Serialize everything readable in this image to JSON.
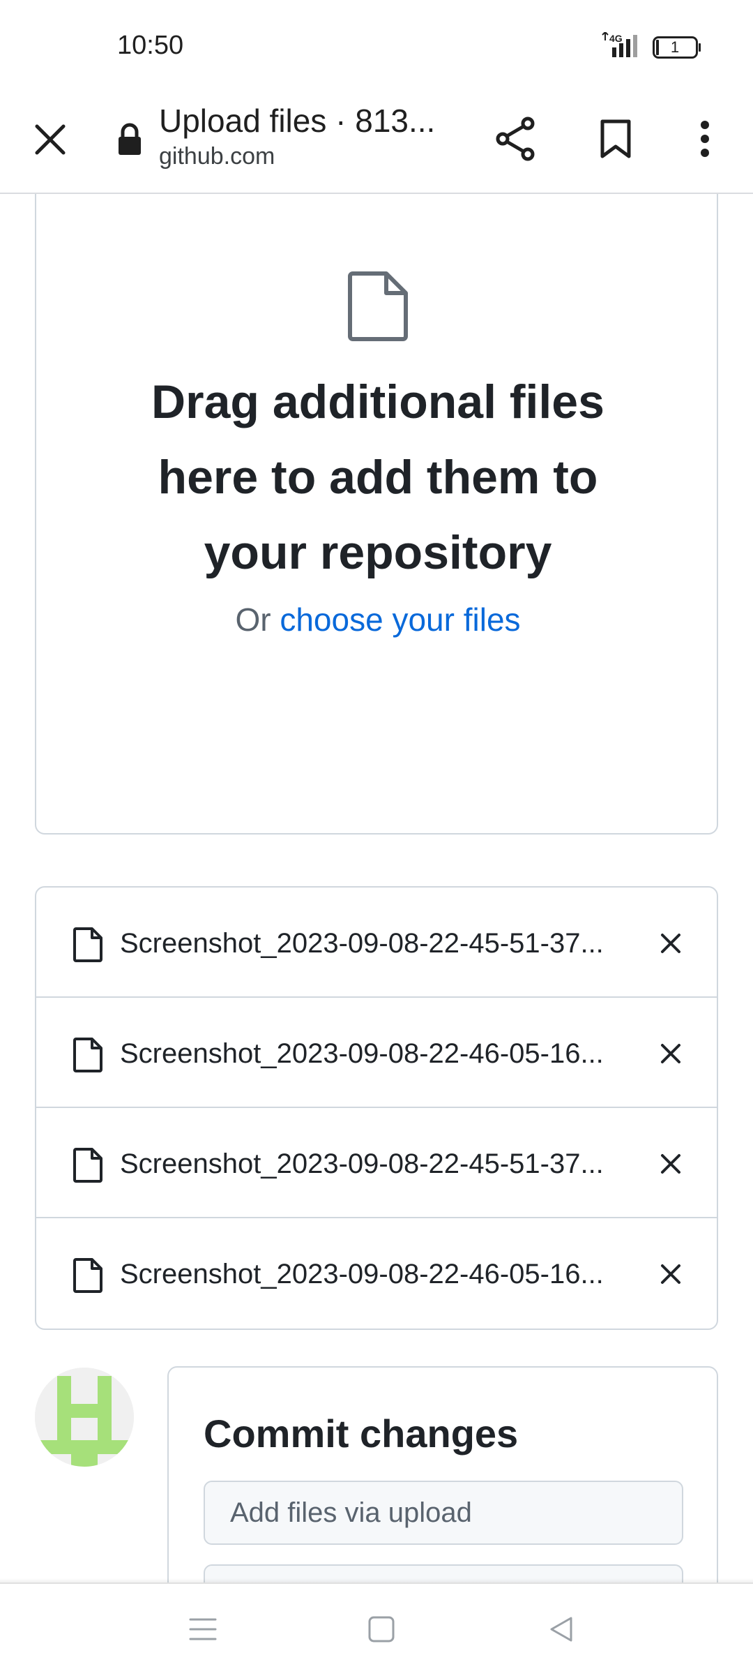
{
  "status_bar": {
    "time": "10:50",
    "network": "4G",
    "battery": "1"
  },
  "toolbar": {
    "title": "Upload files · 813...",
    "url": "github.com",
    "icons": [
      "close-icon",
      "lock-icon",
      "share-icon",
      "bookmark-icon",
      "more-vert-icon"
    ]
  },
  "dropzone": {
    "icon": "file-icon",
    "heading_lines": [
      "Drag additional files",
      "here to add them to",
      "your repository"
    ],
    "sub_prefix": "Or ",
    "sub_link": "choose your files"
  },
  "files": [
    {
      "name": "Screenshot_2023-09-08-22-45-51-37..."
    },
    {
      "name": "Screenshot_2023-09-08-22-46-05-16..."
    },
    {
      "name": "Screenshot_2023-09-08-22-45-51-37..."
    },
    {
      "name": "Screenshot_2023-09-08-22-46-05-16..."
    }
  ],
  "commit": {
    "title": "Commit changes",
    "summary_placeholder": "Add files via upload",
    "avatar_colors": {
      "fg": "#a6e07a",
      "bg": "#f0f0f0"
    }
  },
  "nav_bar": {
    "icons": [
      "menu-icon",
      "home-icon",
      "back-icon"
    ]
  },
  "colors": {
    "link": "#0969da",
    "text": "#1f2328",
    "muted": "#59636e",
    "border": "#d0d7de"
  }
}
